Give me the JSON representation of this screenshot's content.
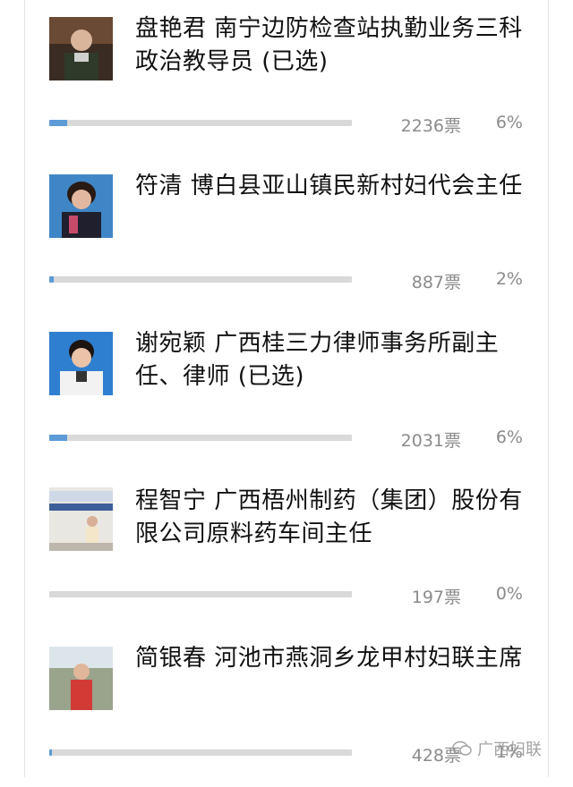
{
  "candidates": [
    {
      "title": "盘艳君 南宁边防检查站执勤业务三科政治教导员 (已选)",
      "votes_label": "2236票",
      "percent_label": "6%",
      "percent": 6
    },
    {
      "title": "符清 博白县亚山镇民新村妇代会主任",
      "votes_label": "887票",
      "percent_label": "2%",
      "percent": 2
    },
    {
      "title": "谢宛颖 广西桂三力律师事务所副主任、律师 (已选)",
      "votes_label": "2031票",
      "percent_label": "6%",
      "percent": 6
    },
    {
      "title": "程智宁 广西梧州制药（集团）股份有限公司原料药车间主任",
      "votes_label": "197票",
      "percent_label": "0%",
      "percent": 0
    },
    {
      "title": "简银春 河池市燕洞乡龙甲村妇联主席",
      "votes_label": "428票",
      "percent_label": "1%",
      "percent": 1
    }
  ],
  "watermark": {
    "text": "广西妇联"
  },
  "colors": {
    "bar_fill": "#5d9bd8",
    "bar_track": "#d9d9d9",
    "meta_text": "#8b8b8b"
  }
}
